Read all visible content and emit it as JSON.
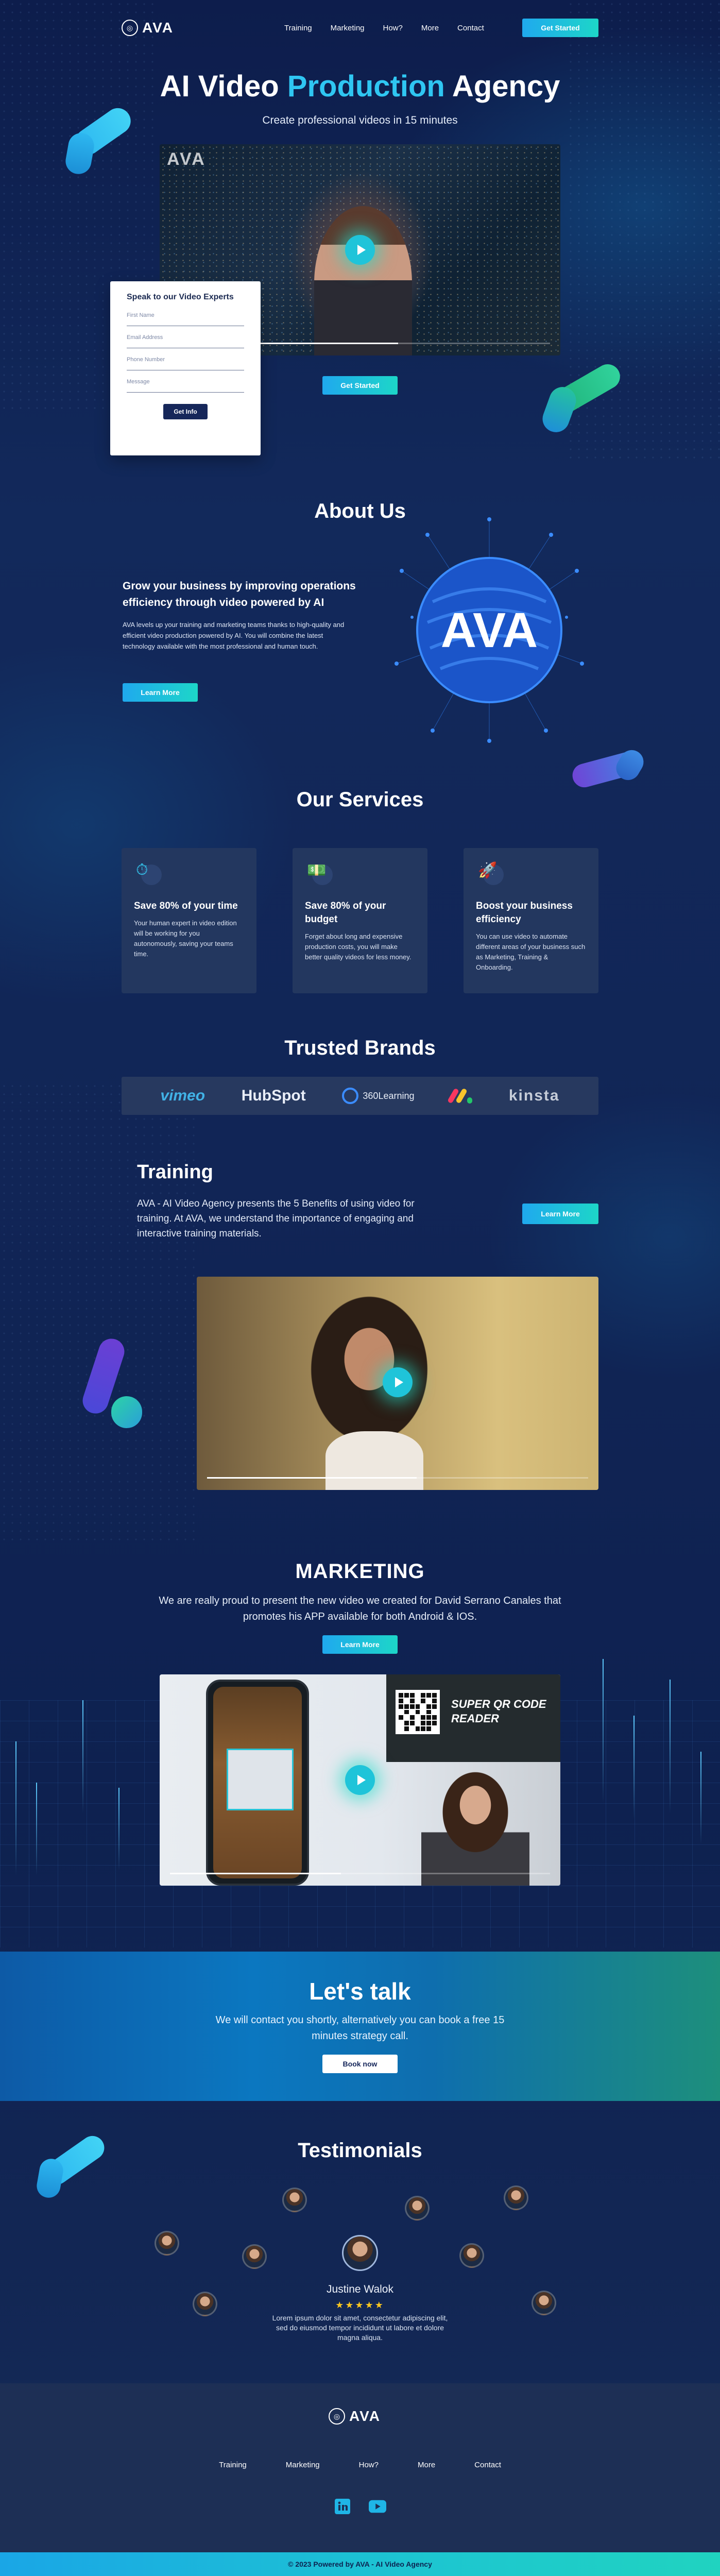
{
  "nav": {
    "logo_text": "AVA",
    "links": [
      "Training",
      "Marketing",
      "How?",
      "More",
      "Contact"
    ],
    "cta": "Get Started"
  },
  "hero": {
    "title_pre": "AI Video",
    "title_accent": "Production",
    "title_post": "Agency",
    "subtitle": "Create professional videos in 15 minutes",
    "video_watermark": "AVA",
    "video_progress": 0.6,
    "cta": "Get Started"
  },
  "form": {
    "title": "Speak to our Video Experts",
    "fields": [
      "First Name",
      "Email Address",
      "Phone Number",
      "Message"
    ],
    "submit": "Get Info"
  },
  "about": {
    "title": "About Us",
    "heading": "Grow your business by improving operations efficiency through video powered by AI",
    "body": "AVA levels up your training and marketing teams thanks to high-quality and efficient video production powered by AI. You will combine the latest technology available with the most professional and human touch.",
    "button": "Learn More",
    "graphic_text": "AVA"
  },
  "services": {
    "title": "Our Services",
    "items": [
      {
        "icon": "stopwatch-icon",
        "title": "Save 80% of your time",
        "body": "Your human expert in video edition will be working for you autonomously, saving your teams time."
      },
      {
        "icon": "money-icon",
        "title": "Save 80% of your budget",
        "body": "Forget about long and expensive production costs, you will make better quality videos for less money."
      },
      {
        "icon": "rocket-icon",
        "title": "Boost your business efficiency",
        "body": "You can use video to automate different areas of your business such as Marketing, Training & Onboarding."
      }
    ]
  },
  "brands": {
    "title": "Trusted Brands",
    "items": [
      "vimeo",
      "HubSpot",
      "360Learning",
      "monday",
      "kinsta"
    ]
  },
  "training": {
    "title": "Training",
    "body": "AVA - AI Video Agency presents the 5 Benefits of using video for training. At AVA, we understand the importance of engaging and interactive training materials.",
    "button": "Learn More",
    "video_progress": 0.55
  },
  "marketing": {
    "title": "MARKETING",
    "body": "We are really proud to present the new video we created for David Serrano Canales that promotes his APP available for both Android & IOS.",
    "button": "Learn More",
    "video_overlay": "SUPER QR CODE READER",
    "video_progress": 0.45
  },
  "talk": {
    "title": "Let's talk",
    "body": "We will contact you shortly, alternatively you can book a free 15 minutes strategy call.",
    "button": "Book now"
  },
  "testimonials": {
    "title": "Testimonials",
    "name": "Justine Walok",
    "stars": "★★★★★",
    "quote": "Lorem ipsum dolor sit amet, consectetur adipiscing elit, sed do eiusmod tempor incididunt ut labore et dolore magna aliqua."
  },
  "footer": {
    "logo_text": "AVA",
    "links": [
      "Training",
      "Marketing",
      "How?",
      "More",
      "Contact"
    ],
    "socials": [
      "linkedin-icon",
      "youtube-icon"
    ],
    "copyright": "© 2023 Powered by AVA - AI Video Agency"
  }
}
